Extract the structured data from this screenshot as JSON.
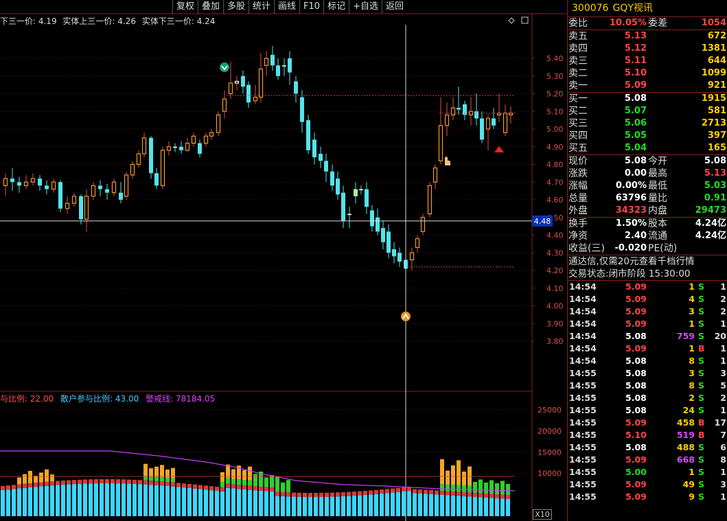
{
  "toolbar": [
    "复权",
    "叠加",
    "多股",
    "统计",
    "画线",
    "F10",
    "标记",
    "+自选",
    "返回"
  ],
  "info_line": {
    "a": "下三一价: 4.19",
    "b": "实体上三一价: 4.26",
    "c": "实体下三一价: 4.24"
  },
  "indicator_line": {
    "a": "与比例: 22.00",
    "b": "散户参与比例: 43.00",
    "c": "警戒线: 78184.05"
  },
  "crosshair_price": "4.48",
  "zoom_label": "X10",
  "price_axis": [
    "5.40",
    "5.30",
    "5.20",
    "5.10",
    "5.00",
    "4.90",
    "4.80",
    "4.70",
    "4.60",
    "4.50",
    "4.40",
    "4.30",
    "4.20",
    "4.10",
    "4.00",
    "3.90",
    "3.80"
  ],
  "vol_axis": [
    "25000",
    "20000",
    "15000",
    "10000"
  ],
  "stock": {
    "code": "300076",
    "name": "GQY视讯"
  },
  "weibi": {
    "label1": "委比",
    "value1": "10.05%",
    "label2": "委差",
    "value2": "1054"
  },
  "sells": [
    {
      "label": "卖五",
      "price": "5.13",
      "vol": "672"
    },
    {
      "label": "卖四",
      "price": "5.12",
      "vol": "1381"
    },
    {
      "label": "卖三",
      "price": "5.11",
      "vol": "644"
    },
    {
      "label": "卖二",
      "price": "5.10",
      "vol": "1099"
    },
    {
      "label": "卖一",
      "price": "5.09",
      "vol": "921"
    }
  ],
  "buys": [
    {
      "label": "买一",
      "price": "5.08",
      "vol": "1915"
    },
    {
      "label": "买二",
      "price": "5.07",
      "vol": "581"
    },
    {
      "label": "买三",
      "price": "5.06",
      "vol": "2713"
    },
    {
      "label": "买四",
      "price": "5.05",
      "vol": "397"
    },
    {
      "label": "买五",
      "price": "5.04",
      "vol": "165"
    }
  ],
  "quote": [
    {
      "l1": "现价",
      "v1": "5.08",
      "l2": "今开",
      "v2": "5.08"
    },
    {
      "l1": "涨跌",
      "v1": "0.00",
      "l2": "最高",
      "v2": "5.13"
    },
    {
      "l1": "涨幅",
      "v1": "0.00%",
      "l2": "最低",
      "v2": "5.03"
    },
    {
      "l1": "总量",
      "v1": "63796",
      "l2": "量比",
      "v2": "0.91"
    },
    {
      "l1": "外盘",
      "v1": "34323",
      "l2": "内盘",
      "v2": "29473"
    }
  ],
  "fin": [
    {
      "l1": "换手",
      "v1": "1.50%",
      "l2": "股本",
      "v2": "4.24亿"
    },
    {
      "l1": "净资",
      "v1": "2.40",
      "l2": "流通",
      "v2": "4.24亿"
    },
    {
      "l1": "收益(三)",
      "v1": "-0.020",
      "l2": "PE(动)",
      "v2": ""
    }
  ],
  "notice": "通达信,仅需20元查看千档行情",
  "status": {
    "label": "交易状态:",
    "value": "闭市阶段",
    "time": "15:30:00"
  },
  "ticks": [
    {
      "t": "14:54",
      "p": "5.09",
      "v": "1",
      "bs": "S",
      "n": "1"
    },
    {
      "t": "14:54",
      "p": "5.09",
      "v": "4",
      "bs": "S",
      "n": "2"
    },
    {
      "t": "14:54",
      "p": "5.09",
      "v": "3",
      "bs": "S",
      "n": "2"
    },
    {
      "t": "14:54",
      "p": "5.09",
      "v": "1",
      "bs": "S",
      "n": "1"
    },
    {
      "t": "14:54",
      "p": "5.08",
      "v": "759",
      "bs": "S",
      "n": "20"
    },
    {
      "t": "14:54",
      "p": "5.09",
      "v": "1",
      "bs": "B",
      "n": "1"
    },
    {
      "t": "14:54",
      "p": "5.08",
      "v": "8",
      "bs": "S",
      "n": "1"
    },
    {
      "t": "14:55",
      "p": "5.08",
      "v": "3",
      "bs": "S",
      "n": "3"
    },
    {
      "t": "14:55",
      "p": "5.08",
      "v": "8",
      "bs": "S",
      "n": "5"
    },
    {
      "t": "14:55",
      "p": "5.08",
      "v": "2",
      "bs": "S",
      "n": "2"
    },
    {
      "t": "14:55",
      "p": "5.08",
      "v": "24",
      "bs": "S",
      "n": "1"
    },
    {
      "t": "14:55",
      "p": "5.09",
      "v": "458",
      "bs": "B",
      "n": "17"
    },
    {
      "t": "14:55",
      "p": "5.10",
      "v": "519",
      "bs": "B",
      "n": "7"
    },
    {
      "t": "14:55",
      "p": "5.08",
      "v": "488",
      "bs": "S",
      "n": "6"
    },
    {
      "t": "14:55",
      "p": "5.09",
      "v": "668",
      "bs": "S",
      "n": "8"
    },
    {
      "t": "14:55",
      "p": "5.00",
      "v": "1",
      "bs": "S",
      "n": "1"
    },
    {
      "t": "14:55",
      "p": "5.09",
      "v": "49",
      "bs": "S",
      "n": "3"
    },
    {
      "t": "14:55",
      "p": "5.09",
      "v": "9",
      "bs": "S",
      "n": "1"
    }
  ]
}
